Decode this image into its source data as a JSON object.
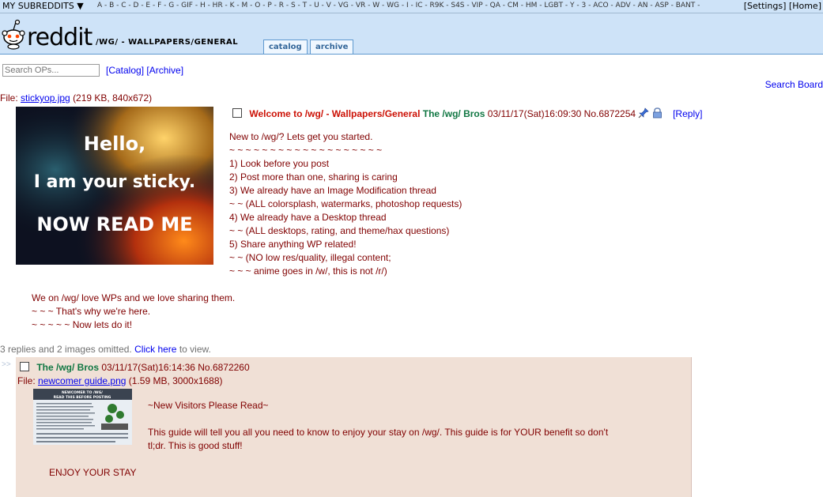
{
  "topbar": {
    "my_subreddits": "MY SUBREDDITS ▼",
    "letters": "A - B - C - D - E - F - G - GIF - H - HR - K - M - O - P - R - S - T - U - V - VG - VR - W - WG - I - IC - R9K - S4S - VIP - QA - CM - HM - LGBT - Y - 3 - ACO - ADV - AN - ASP - BANT -",
    "settings": "Settings",
    "home": "Home"
  },
  "header": {
    "logo_text": "reddit",
    "board_title": "/WG/ - WALLPAPERS/GENERAL",
    "tabs": [
      "catalog",
      "archive"
    ]
  },
  "nav": {
    "search_placeholder": "Search OPs...",
    "catalog": "[Catalog]",
    "archive": "[Archive]",
    "search_board": "Search Board"
  },
  "op": {
    "file_label": "File:",
    "file_name": "stickyop.jpg",
    "file_meta": "(219 KB, 840x672)",
    "image_lines": [
      "Hello,",
      "I am your sticky.",
      "NOW READ ME"
    ],
    "subject": "Welcome to /wg/ - Wallpapers/General",
    "name": "The /wg/ Bros",
    "datetime": "03/11/17(Sat)16:09:30",
    "post_no": "No.6872254",
    "reply": "[Reply]",
    "body": [
      "New to /wg/? Lets get you started.",
      "~ ~ ~ ~ ~ ~ ~ ~ ~ ~ ~ ~ ~ ~ ~ ~ ~ ~ ~",
      "1) Look before you post",
      "2) Post more than one, sharing is caring",
      "3) We already have an Image Modification thread",
      "~ ~ (ALL colorsplash, watermarks, photoshop requests)",
      "4) We already have a Desktop thread",
      "~ ~ (ALL desktops, rating, and theme/hax questions)",
      "5) Share anything WP related!",
      "~ ~ (NO low res/quality, illegal content;",
      "~ ~ ~ anime goes in /w/, this is not /r/)"
    ],
    "body2": [
      "We on /wg/ love WPs and we love sharing them.",
      "~ ~ ~ That's why we're here.",
      "~ ~ ~ ~ ~ Now lets do it!"
    ]
  },
  "omitted": {
    "text": "3 replies and 2 images omitted.",
    "link": "Click here",
    "suffix": "to view."
  },
  "reply1": {
    "arrows": ">>",
    "name": "The /wg/ Bros",
    "datetime": "03/11/17(Sat)16:14:36",
    "post_no": "No.6872260",
    "file_label": "File:",
    "file_name": "newcomer guide.png",
    "file_meta": "(1.59 MB, 3000x1688)",
    "thumb_title1": "NEWCOMER TO /WG/",
    "thumb_title2": "READ THIS BEFORE POSTING",
    "body": [
      "~New Visitors Please Read~",
      "",
      "This guide will tell you all you need to know to enjoy your stay on /wg/. This guide is for YOUR benefit so don't",
      "tl;dr. This is good stuff!"
    ],
    "enjoy": "ENJOY YOUR STAY"
  }
}
